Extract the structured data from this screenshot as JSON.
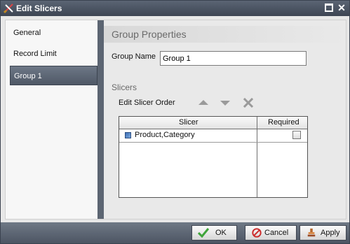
{
  "window": {
    "title": "Edit Slicers"
  },
  "sidebar": {
    "items": [
      {
        "label": "General"
      },
      {
        "label": "Record Limit"
      },
      {
        "label": "Group 1"
      }
    ]
  },
  "panel": {
    "header": "Group Properties",
    "group_name_label": "Group Name",
    "group_name_value": "Group 1",
    "section_label": "Slicers",
    "edit_order_label": "Edit Slicer Order"
  },
  "table": {
    "columns": [
      "Slicer",
      "Required"
    ],
    "rows": [
      {
        "slicer": "Product,Category",
        "required": false
      }
    ]
  },
  "footer": {
    "ok": "OK",
    "cancel": "Cancel",
    "apply": "Apply"
  },
  "colors": {
    "titlebar": "#4a5361",
    "accent_selected": "#5d6675",
    "ok_check": "#3fa43a",
    "cancel_red": "#cc2a2a"
  }
}
